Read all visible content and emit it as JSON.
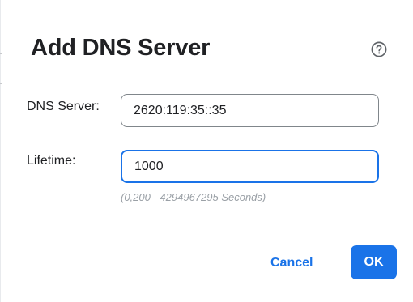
{
  "dialog": {
    "title": "Add DNS Server",
    "help_icon": "help-circle-icon",
    "fields": {
      "dns_server": {
        "label": "DNS Server:",
        "value": "2620:119:35::35"
      },
      "lifetime": {
        "label": "Lifetime:",
        "value": "1000",
        "hint": "(0,200 - 4294967295 Seconds)"
      }
    },
    "buttons": {
      "cancel": "Cancel",
      "ok": "OK"
    }
  },
  "colors": {
    "accent": "#1a73e8",
    "text": "#202124",
    "hint": "#9aa0a6",
    "input_border": "#80868b"
  }
}
